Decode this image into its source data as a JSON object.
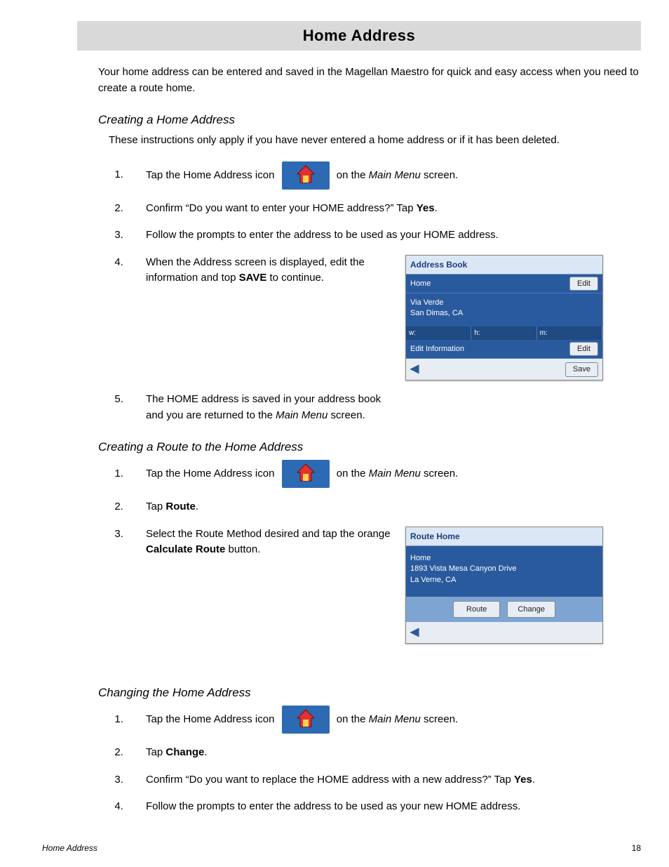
{
  "title": "Home Address",
  "intro": "Your home address can be entered and saved in the Magellan Maestro for quick and easy access when you need to create a route home.",
  "sections": {
    "creating": {
      "heading": "Creating a Home Address",
      "note": "These instructions only apply if you have never entered a home address or if it has been deleted.",
      "steps": {
        "s1a": "Tap the Home Address icon ",
        "s1b": " on the ",
        "s1menu": "Main Menu",
        "s1c": " screen.",
        "s2a": "Confirm “Do you want to enter your HOME address?”  Tap ",
        "s2b": "Yes",
        "s2c": ".",
        "s3": "Follow the prompts to enter the address to be used as your HOME address.",
        "s4a": "When the Address screen is displayed, edit the information and top ",
        "s4b": "SAVE",
        "s4c": " to continue.",
        "s5a": "The HOME address is saved in your address book and you are returned to the ",
        "s5menu": "Main Menu",
        "s5b": " screen."
      }
    },
    "routing": {
      "heading": "Creating a Route to the Home Address",
      "steps": {
        "s1a": "Tap the Home Address icon ",
        "s1b": " on the ",
        "s1menu": "Main Menu",
        "s1c": " screen.",
        "s2a": "Tap ",
        "s2b": "Route",
        "s2c": ".",
        "s3a": "Select the Route Method desired and tap the orange ",
        "s3b": "Calculate Route",
        "s3c": " button."
      }
    },
    "changing": {
      "heading": "Changing the Home Address",
      "steps": {
        "s1a": "Tap the Home Address icon ",
        "s1b": " on the ",
        "s1menu": "Main Menu",
        "s1c": " screen.",
        "s2a": "Tap ",
        "s2b": "Change",
        "s2c": ".",
        "s3a": "Confirm “Do you want to replace the HOME address with a new address?”  Tap ",
        "s3b": "Yes",
        "s3c": ".",
        "s4": "Follow the prompts to enter the address to be used as your new HOME address."
      }
    }
  },
  "device1": {
    "header": "Address Book",
    "row_home": "Home",
    "edit": "Edit",
    "addr1": "Via Verde",
    "addr2": "San Dimas, CA",
    "phone_w": "w:",
    "phone_h": "h:",
    "phone_m": "m:",
    "editinfo": "Edit Information",
    "save": "Save"
  },
  "device2": {
    "header": "Route Home",
    "label_home": "Home",
    "addr1": "1893 Vista Mesa Canyon Drive",
    "addr2": "La Verne, CA",
    "route": "Route",
    "change": "Change"
  },
  "footer": {
    "title": "Home Address",
    "page": "18"
  }
}
